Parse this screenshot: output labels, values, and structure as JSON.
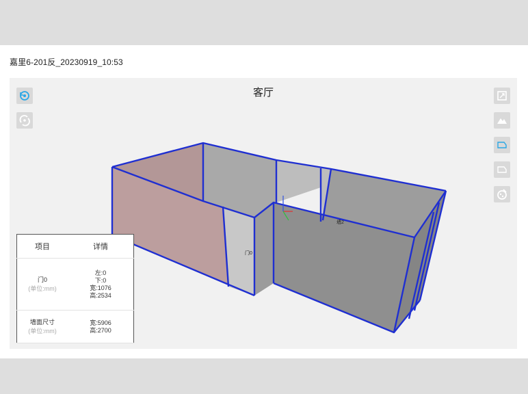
{
  "header": {
    "file_title": "嘉里6-201反_20230919_10:53"
  },
  "viewport": {
    "room_name": "客厅",
    "left_tools": [
      {
        "name": "reset-view-icon",
        "active": true
      },
      {
        "name": "rotate-icon",
        "active": false
      }
    ],
    "right_tools": [
      {
        "name": "fullscreen-icon"
      },
      {
        "name": "mountain-view-icon"
      },
      {
        "name": "floor-shape-icon"
      },
      {
        "name": "floor-plan-icon"
      },
      {
        "name": "paint-palette-icon"
      }
    ],
    "scene_labels": {
      "door": "门0",
      "wall": "墙2"
    }
  },
  "info_table": {
    "headers": [
      "项目",
      "详情"
    ],
    "rows": [
      {
        "item": "门0",
        "unit": "(单位:mm)",
        "details": [
          "左:0",
          "下:0",
          "宽:1076",
          "高:2534"
        ]
      },
      {
        "item": "墙面尺寸",
        "unit": "(单位:mm)",
        "details": [
          "宽:5906",
          "高:2700"
        ]
      }
    ]
  },
  "colors": {
    "accent": "#2aa7e6",
    "edge": "#1f2fd1",
    "wall_gray": "#9a9a9a",
    "highlight_wall": "#b79a9a"
  }
}
